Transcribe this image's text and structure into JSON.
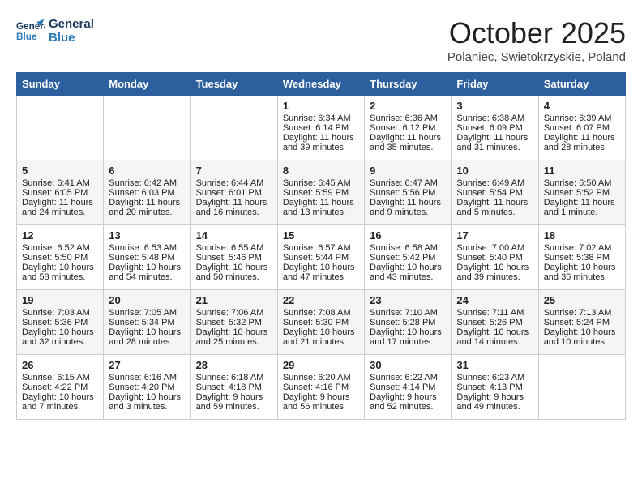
{
  "header": {
    "logo_line1": "General",
    "logo_line2": "Blue",
    "month": "October 2025",
    "location": "Polaniec, Swietokrzyskie, Poland"
  },
  "weekdays": [
    "Sunday",
    "Monday",
    "Tuesday",
    "Wednesday",
    "Thursday",
    "Friday",
    "Saturday"
  ],
  "weeks": [
    [
      {
        "day": "",
        "text": ""
      },
      {
        "day": "",
        "text": ""
      },
      {
        "day": "",
        "text": ""
      },
      {
        "day": "1",
        "text": "Sunrise: 6:34 AM\nSunset: 6:14 PM\nDaylight: 11 hours\nand 39 minutes."
      },
      {
        "day": "2",
        "text": "Sunrise: 6:36 AM\nSunset: 6:12 PM\nDaylight: 11 hours\nand 35 minutes."
      },
      {
        "day": "3",
        "text": "Sunrise: 6:38 AM\nSunset: 6:09 PM\nDaylight: 11 hours\nand 31 minutes."
      },
      {
        "day": "4",
        "text": "Sunrise: 6:39 AM\nSunset: 6:07 PM\nDaylight: 11 hours\nand 28 minutes."
      }
    ],
    [
      {
        "day": "5",
        "text": "Sunrise: 6:41 AM\nSunset: 6:05 PM\nDaylight: 11 hours\nand 24 minutes."
      },
      {
        "day": "6",
        "text": "Sunrise: 6:42 AM\nSunset: 6:03 PM\nDaylight: 11 hours\nand 20 minutes."
      },
      {
        "day": "7",
        "text": "Sunrise: 6:44 AM\nSunset: 6:01 PM\nDaylight: 11 hours\nand 16 minutes."
      },
      {
        "day": "8",
        "text": "Sunrise: 6:45 AM\nSunset: 5:59 PM\nDaylight: 11 hours\nand 13 minutes."
      },
      {
        "day": "9",
        "text": "Sunrise: 6:47 AM\nSunset: 5:56 PM\nDaylight: 11 hours\nand 9 minutes."
      },
      {
        "day": "10",
        "text": "Sunrise: 6:49 AM\nSunset: 5:54 PM\nDaylight: 11 hours\nand 5 minutes."
      },
      {
        "day": "11",
        "text": "Sunrise: 6:50 AM\nSunset: 5:52 PM\nDaylight: 11 hours\nand 1 minute."
      }
    ],
    [
      {
        "day": "12",
        "text": "Sunrise: 6:52 AM\nSunset: 5:50 PM\nDaylight: 10 hours\nand 58 minutes."
      },
      {
        "day": "13",
        "text": "Sunrise: 6:53 AM\nSunset: 5:48 PM\nDaylight: 10 hours\nand 54 minutes."
      },
      {
        "day": "14",
        "text": "Sunrise: 6:55 AM\nSunset: 5:46 PM\nDaylight: 10 hours\nand 50 minutes."
      },
      {
        "day": "15",
        "text": "Sunrise: 6:57 AM\nSunset: 5:44 PM\nDaylight: 10 hours\nand 47 minutes."
      },
      {
        "day": "16",
        "text": "Sunrise: 6:58 AM\nSunset: 5:42 PM\nDaylight: 10 hours\nand 43 minutes."
      },
      {
        "day": "17",
        "text": "Sunrise: 7:00 AM\nSunset: 5:40 PM\nDaylight: 10 hours\nand 39 minutes."
      },
      {
        "day": "18",
        "text": "Sunrise: 7:02 AM\nSunset: 5:38 PM\nDaylight: 10 hours\nand 36 minutes."
      }
    ],
    [
      {
        "day": "19",
        "text": "Sunrise: 7:03 AM\nSunset: 5:36 PM\nDaylight: 10 hours\nand 32 minutes."
      },
      {
        "day": "20",
        "text": "Sunrise: 7:05 AM\nSunset: 5:34 PM\nDaylight: 10 hours\nand 28 minutes."
      },
      {
        "day": "21",
        "text": "Sunrise: 7:06 AM\nSunset: 5:32 PM\nDaylight: 10 hours\nand 25 minutes."
      },
      {
        "day": "22",
        "text": "Sunrise: 7:08 AM\nSunset: 5:30 PM\nDaylight: 10 hours\nand 21 minutes."
      },
      {
        "day": "23",
        "text": "Sunrise: 7:10 AM\nSunset: 5:28 PM\nDaylight: 10 hours\nand 17 minutes."
      },
      {
        "day": "24",
        "text": "Sunrise: 7:11 AM\nSunset: 5:26 PM\nDaylight: 10 hours\nand 14 minutes."
      },
      {
        "day": "25",
        "text": "Sunrise: 7:13 AM\nSunset: 5:24 PM\nDaylight: 10 hours\nand 10 minutes."
      }
    ],
    [
      {
        "day": "26",
        "text": "Sunrise: 6:15 AM\nSunset: 4:22 PM\nDaylight: 10 hours\nand 7 minutes."
      },
      {
        "day": "27",
        "text": "Sunrise: 6:16 AM\nSunset: 4:20 PM\nDaylight: 10 hours\nand 3 minutes."
      },
      {
        "day": "28",
        "text": "Sunrise: 6:18 AM\nSunset: 4:18 PM\nDaylight: 9 hours\nand 59 minutes."
      },
      {
        "day": "29",
        "text": "Sunrise: 6:20 AM\nSunset: 4:16 PM\nDaylight: 9 hours\nand 56 minutes."
      },
      {
        "day": "30",
        "text": "Sunrise: 6:22 AM\nSunset: 4:14 PM\nDaylight: 9 hours\nand 52 minutes."
      },
      {
        "day": "31",
        "text": "Sunrise: 6:23 AM\nSunset: 4:13 PM\nDaylight: 9 hours\nand 49 minutes."
      },
      {
        "day": "",
        "text": ""
      }
    ]
  ]
}
